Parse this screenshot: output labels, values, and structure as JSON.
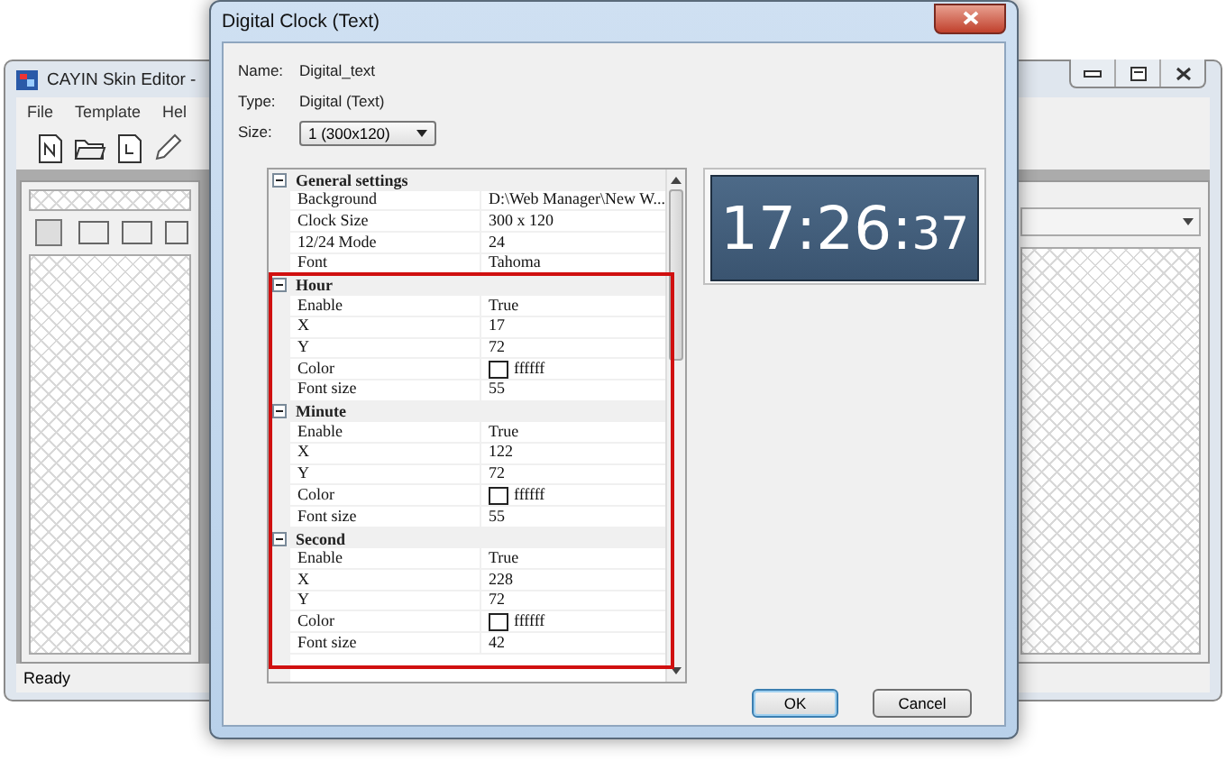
{
  "background_window": {
    "title": "CAYIN Skin Editor -",
    "menu": [
      "File",
      "Template",
      "Hel"
    ],
    "status": "Ready"
  },
  "dialog": {
    "title": "Digital Clock (Text)",
    "fields": [
      {
        "label": "Name:",
        "value": "Digital_text",
        "kind": "text"
      },
      {
        "label": "Type:",
        "value": "Digital (Text)",
        "kind": "text"
      },
      {
        "label": "Size:",
        "value": "1  (300x120)",
        "kind": "select"
      }
    ],
    "properties": [
      {
        "category": "General settings",
        "expanded": true,
        "highlighted": false,
        "rows": [
          {
            "name": "Background",
            "value": "D:\\Web Manager\\New W...",
            "kind": "text"
          },
          {
            "name": "Clock Size",
            "value": "300 x 120",
            "kind": "text"
          },
          {
            "name": "12/24 Mode",
            "value": "24",
            "kind": "text"
          },
          {
            "name": "Font",
            "value": "Tahoma",
            "kind": "text"
          }
        ]
      },
      {
        "category": "Hour",
        "expanded": true,
        "highlighted": true,
        "rows": [
          {
            "name": "Enable",
            "value": "True",
            "kind": "text"
          },
          {
            "name": "X",
            "value": "17",
            "kind": "text"
          },
          {
            "name": "Y",
            "value": "72",
            "kind": "text"
          },
          {
            "name": "Color",
            "value": "ffffff",
            "kind": "color",
            "color": "#ffffff"
          },
          {
            "name": "Font size",
            "value": "55",
            "kind": "text"
          }
        ]
      },
      {
        "category": "Minute",
        "expanded": true,
        "highlighted": true,
        "rows": [
          {
            "name": "Enable",
            "value": "True",
            "kind": "text"
          },
          {
            "name": "X",
            "value": "122",
            "kind": "text"
          },
          {
            "name": "Y",
            "value": "72",
            "kind": "text"
          },
          {
            "name": "Color",
            "value": "ffffff",
            "kind": "color",
            "color": "#ffffff"
          },
          {
            "name": "Font size",
            "value": "55",
            "kind": "text"
          }
        ]
      },
      {
        "category": "Second",
        "expanded": true,
        "highlighted": true,
        "rows": [
          {
            "name": "Enable",
            "value": "True",
            "kind": "text"
          },
          {
            "name": "X",
            "value": "228",
            "kind": "text"
          },
          {
            "name": "Y",
            "value": "72",
            "kind": "text"
          },
          {
            "name": "Color",
            "value": "ffffff",
            "kind": "color",
            "color": "#ffffff"
          },
          {
            "name": "Font size",
            "value": "42",
            "kind": "text"
          }
        ]
      }
    ],
    "preview": {
      "main": "17:26:",
      "seconds": "37"
    },
    "buttons": [
      {
        "label": "OK",
        "default": true
      },
      {
        "label": "Cancel",
        "default": false
      }
    ]
  }
}
